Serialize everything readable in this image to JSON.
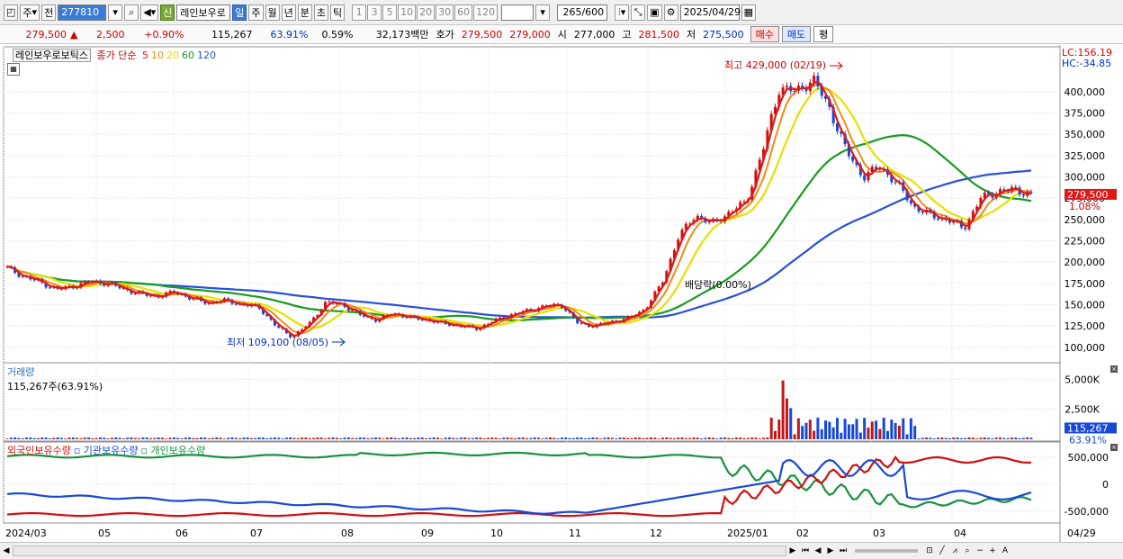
{
  "toolbar": {
    "period": "주",
    "prev": "전",
    "code": "277810",
    "new_badge": "신",
    "name": "레인보우로",
    "intervals": [
      "일",
      "주",
      "월",
      "년",
      "분",
      "초",
      "틱"
    ],
    "active_interval": 0,
    "minutes": [
      "1",
      "3",
      "5",
      "10",
      "20",
      "30",
      "60",
      "120"
    ],
    "count": "265",
    "count_total": "/600",
    "date": "2025/04/29"
  },
  "quote": {
    "price": "279,500",
    "arrow": "▲",
    "change": "2,500",
    "pct": "+0.90%",
    "volume": "115,267",
    "vol_ratio": "63.91%",
    "turnover": "0.59%",
    "amount": "32,173백만",
    "bid_label": "호가",
    "ask": "279,500",
    "bid": "279,000",
    "open_label": "시",
    "open": "277,000",
    "high_label": "고",
    "high": "281,500",
    "low_label": "저",
    "low": "275,500",
    "buy": "매수",
    "sell": "매도",
    "avg": "평"
  },
  "price_legend": {
    "name": "레인보우로보틱스",
    "label": "종가 단순",
    "ma": [
      {
        "n": "5",
        "color": "#e01818"
      },
      {
        "n": "10",
        "color": "#f08c14"
      },
      {
        "n": "20",
        "color": "#e8e000"
      },
      {
        "n": "60",
        "color": "#189c20"
      },
      {
        "n": "120",
        "color": "#2850d8"
      }
    ]
  },
  "price_axis": {
    "ticks": [
      "400,000",
      "375,000",
      "350,000",
      "325,000",
      "300,000",
      "275,000",
      "250,000",
      "225,000",
      "200,000",
      "175,000",
      "150,000",
      "125,000",
      "100,000"
    ],
    "lc": "LC:156.19",
    "hc": "HC:-34.85",
    "current": "279,500",
    "current_pct": "1.08%"
  },
  "annotations": {
    "high": "최고 429,000 (02/19)",
    "low": "최저 109,100 (08/05)",
    "dividend": "배당락(0.00%)"
  },
  "volume_panel": {
    "title": "거래량",
    "value": "115,267주(63.91%)",
    "ticks": [
      "5,000K",
      "2,500K"
    ],
    "current": "115,267",
    "current_pct": "63.91%"
  },
  "holding_panel": {
    "legend": [
      {
        "label": "외국인보유수량",
        "color": "#d01010"
      },
      {
        "label": "기관보유수량",
        "color": "#1848d8"
      },
      {
        "label": "개인보유수량",
        "color": "#189040"
      }
    ],
    "ticks": [
      "500,000",
      "0",
      "-500,000"
    ]
  },
  "x_axis": {
    "labels": [
      "2024/03",
      "05",
      "06",
      "07",
      "08",
      "09",
      "10",
      "11",
      "12",
      "2025/01",
      "02",
      "03",
      "04"
    ],
    "end_label": "04/29"
  },
  "chart_data": {
    "type": "line",
    "price_range": [
      85000,
      440000
    ],
    "closes": [
      193000,
      183000,
      176000,
      168000,
      172000,
      177000,
      175000,
      168000,
      162000,
      160000,
      165000,
      157000,
      152000,
      155000,
      150000,
      147000,
      125000,
      112000,
      128000,
      153000,
      150000,
      138000,
      132000,
      140000,
      135000,
      132000,
      128000,
      125000,
      122000,
      131000,
      138000,
      143000,
      148000,
      150000,
      128000,
      125000,
      130000,
      134000,
      145000,
      175000,
      230000,
      255000,
      245000,
      258000,
      270000,
      330000,
      405000,
      400000,
      415000,
      380000,
      330000,
      300000,
      312000,
      292000,
      265000,
      255000,
      250000,
      240000,
      275000,
      283000,
      285000,
      279500
    ]
  }
}
